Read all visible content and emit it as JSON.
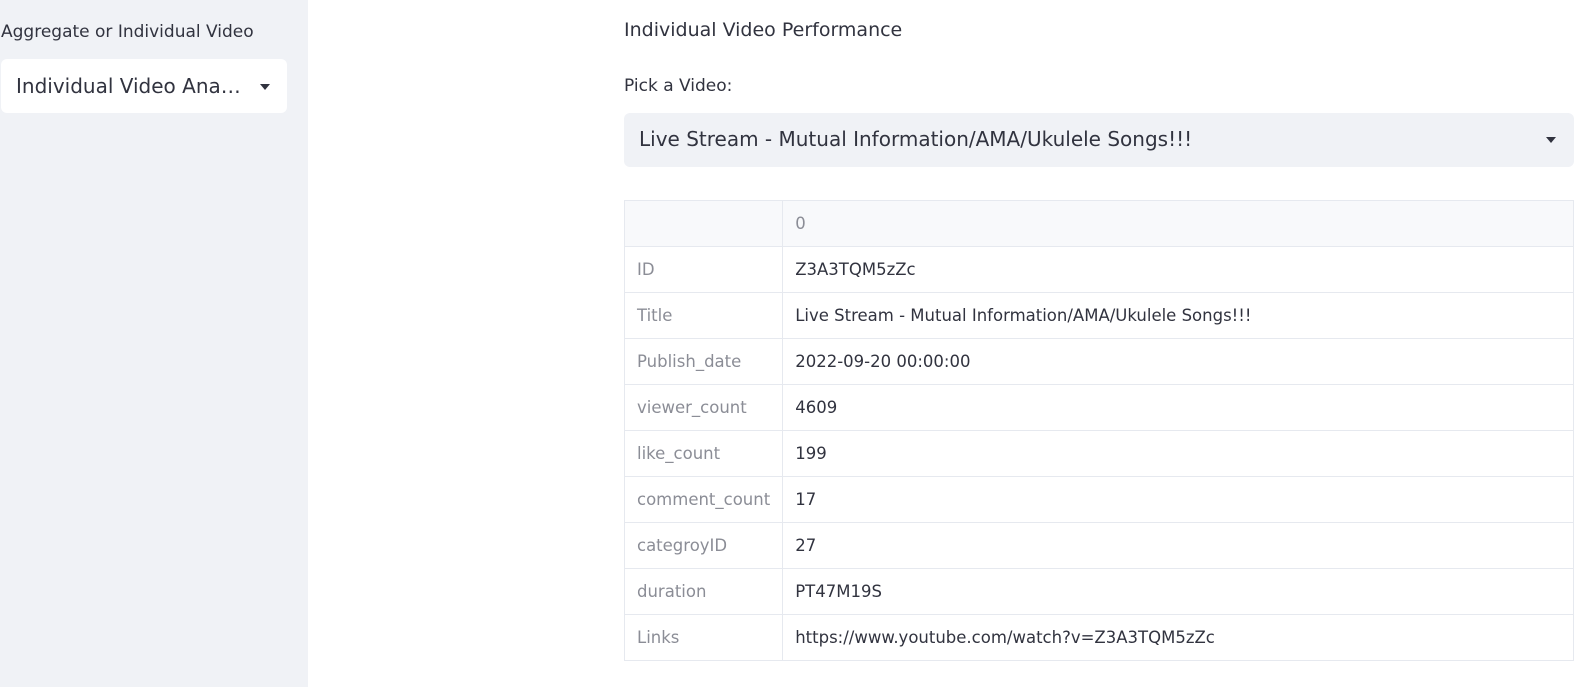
{
  "sidebar": {
    "label": "Aggregate or Individual Video",
    "select_value": "Individual Video Analysis"
  },
  "main": {
    "section_title": "Individual Video Performance",
    "pick_label": "Pick a Video:",
    "select_value": "Live Stream - Mutual Information/AMA/Ukulele Songs!!!",
    "table": {
      "column_header": "0",
      "rows": [
        {
          "key": "ID",
          "value": "Z3A3TQM5zZc"
        },
        {
          "key": "Title",
          "value": "Live Stream - Mutual Information/AMA/Ukulele Songs!!!"
        },
        {
          "key": "Publish_date",
          "value": "2022-09-20 00:00:00"
        },
        {
          "key": "viewer_count",
          "value": "4609"
        },
        {
          "key": "like_count",
          "value": "199"
        },
        {
          "key": "comment_count",
          "value": "17"
        },
        {
          "key": "categroyID",
          "value": "27"
        },
        {
          "key": "duration",
          "value": "PT47M19S"
        },
        {
          "key": "Links",
          "value": "https://www.youtube.com/watch?v=Z3A3TQM5zZc"
        }
      ]
    }
  },
  "colors": {
    "sidebar_bg": "#f0f2f6",
    "text": "#31333f",
    "muted_text": "#8b8d96",
    "border": "#e6e9ef"
  },
  "icons": {
    "dropdown": "caret-down-icon"
  }
}
